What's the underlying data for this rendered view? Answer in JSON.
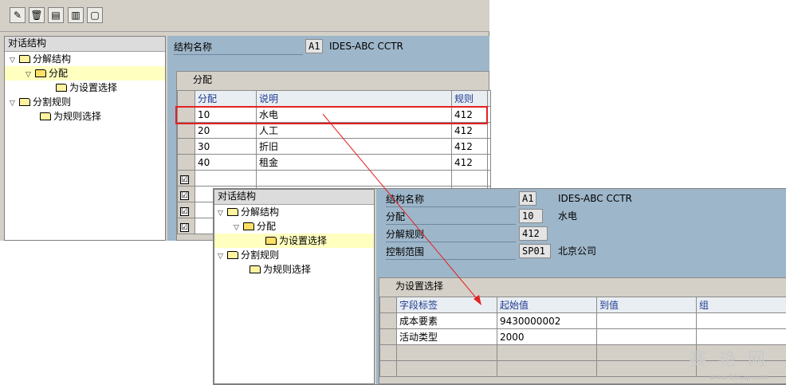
{
  "back_window": {
    "toolbar": {
      "icons": [
        "edit-pencil-icon",
        "delete-trash-icon",
        "detail-list-icon",
        "export-icon",
        "document-icon"
      ],
      "glyphs": [
        "✎",
        "🗑",
        "▤",
        "▥",
        "▢"
      ]
    },
    "tree": {
      "title": "对话结构",
      "nodes": [
        {
          "label": "分解结构",
          "expanded": true
        },
        {
          "label": "分配",
          "expanded": true,
          "selected": true
        },
        {
          "label": "为设置选择"
        },
        {
          "label": "分割规则",
          "expanded": true
        },
        {
          "label": "为规则选择"
        }
      ]
    },
    "header": {
      "field_label": "结构名称",
      "code": "A1",
      "name": "IDES-ABC CCTR"
    },
    "table": {
      "title": "分配",
      "columns": [
        "分配",
        "说明",
        "规则"
      ],
      "rows": [
        {
          "alloc": "10",
          "desc": "水电",
          "rule": "412"
        },
        {
          "alloc": "20",
          "desc": "人工",
          "rule": "412"
        },
        {
          "alloc": "30",
          "desc": "折旧",
          "rule": "412"
        },
        {
          "alloc": "40",
          "desc": "租金",
          "rule": "412"
        }
      ],
      "checkbox_mark": "☑"
    }
  },
  "front_window": {
    "tree": {
      "title": "对话结构",
      "nodes": [
        {
          "label": "分解结构",
          "expanded": true
        },
        {
          "label": "分配",
          "expanded": true
        },
        {
          "label": "为设置选择",
          "selected": true
        },
        {
          "label": "分割规则",
          "expanded": true
        },
        {
          "label": "为规则选择"
        }
      ]
    },
    "header": {
      "structure": {
        "label": "结构名称",
        "code": "A1",
        "text": "IDES-ABC CCTR"
      },
      "allocation": {
        "label": "分配",
        "code": "10",
        "text": "水电"
      },
      "split_rule": {
        "label": "分解规则",
        "code": "412"
      },
      "controlling_area": {
        "label": "控制范围",
        "code": "SP01",
        "text": "北京公司"
      }
    },
    "table": {
      "title": "为设置选择",
      "columns": [
        "字段标签",
        "起始值",
        "到值",
        "组"
      ],
      "rows": [
        {
          "field": "成本要素",
          "from": "9430000002",
          "to": "",
          "group": ""
        },
        {
          "field": "活动类型",
          "from": "2000",
          "to": "",
          "group": ""
        }
      ]
    }
  },
  "colors": {
    "highlight_box": "#e32222",
    "arrow": "#e32222",
    "selected_node": "#ffffc0",
    "pane_blue": "#9eb6c9"
  },
  "watermark": {
    "text": "赛 艳 网",
    "url": "www.91sap.com"
  }
}
